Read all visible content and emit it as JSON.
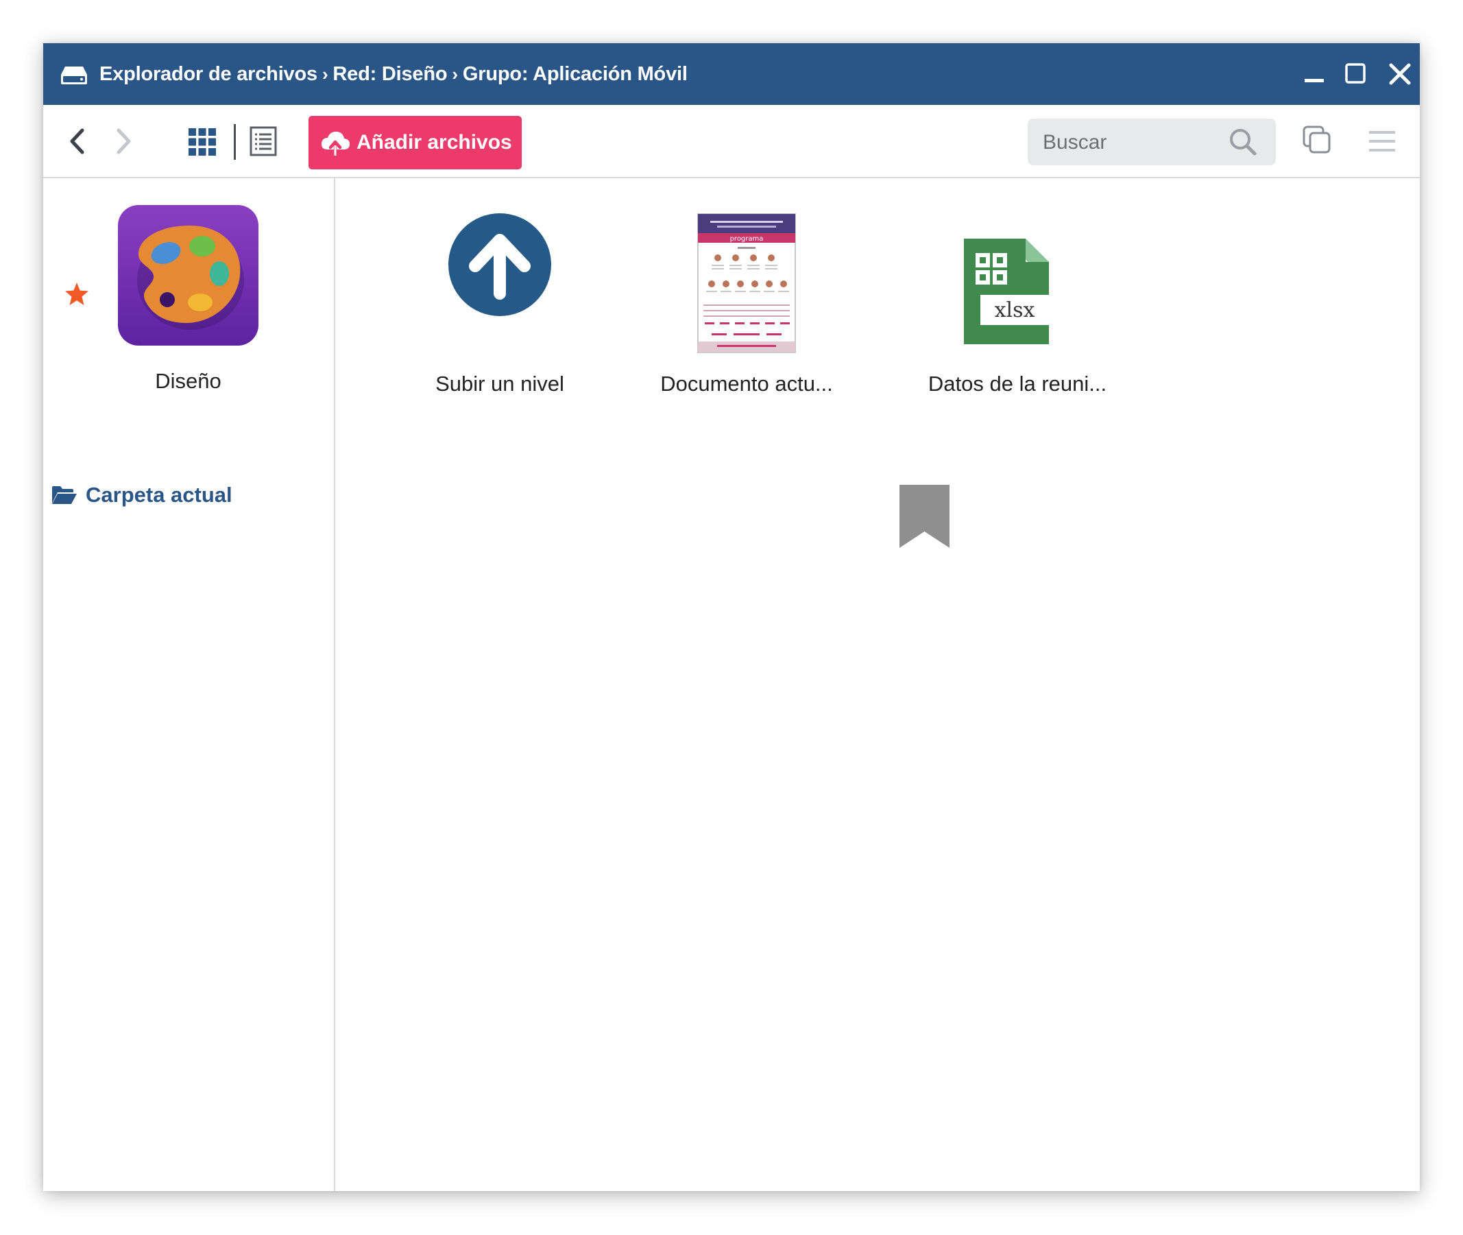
{
  "window": {
    "breadcrumb": [
      "Explorador de archivos",
      "Red: Diseño",
      "Grupo: Aplicación Móvil"
    ],
    "breadcrumb_separator": "›",
    "controls": [
      "minimize-icon",
      "maximize-icon",
      "close-icon"
    ]
  },
  "toolbar": {
    "add_files_label": "Añadir archivos",
    "search_placeholder": "Buscar",
    "search_value": "",
    "accent_color": "#ec3a6a",
    "titlebar_color": "#2a5587"
  },
  "sidebar": {
    "favorite": {
      "label": "Diseño",
      "icon": "palette-icon",
      "starred": true
    },
    "current_folder_label": "Carpeta actual"
  },
  "main": {
    "items": [
      {
        "label": "Subir un nivel",
        "icon": "arrow-up-circle-icon"
      },
      {
        "label": "Documento actu...",
        "icon": "document-thumbnail"
      },
      {
        "label": "Datos de la reuni...",
        "icon": "xlsx-file-icon",
        "file_type": "xlsx"
      }
    ],
    "thumbnail_header": "programa"
  }
}
